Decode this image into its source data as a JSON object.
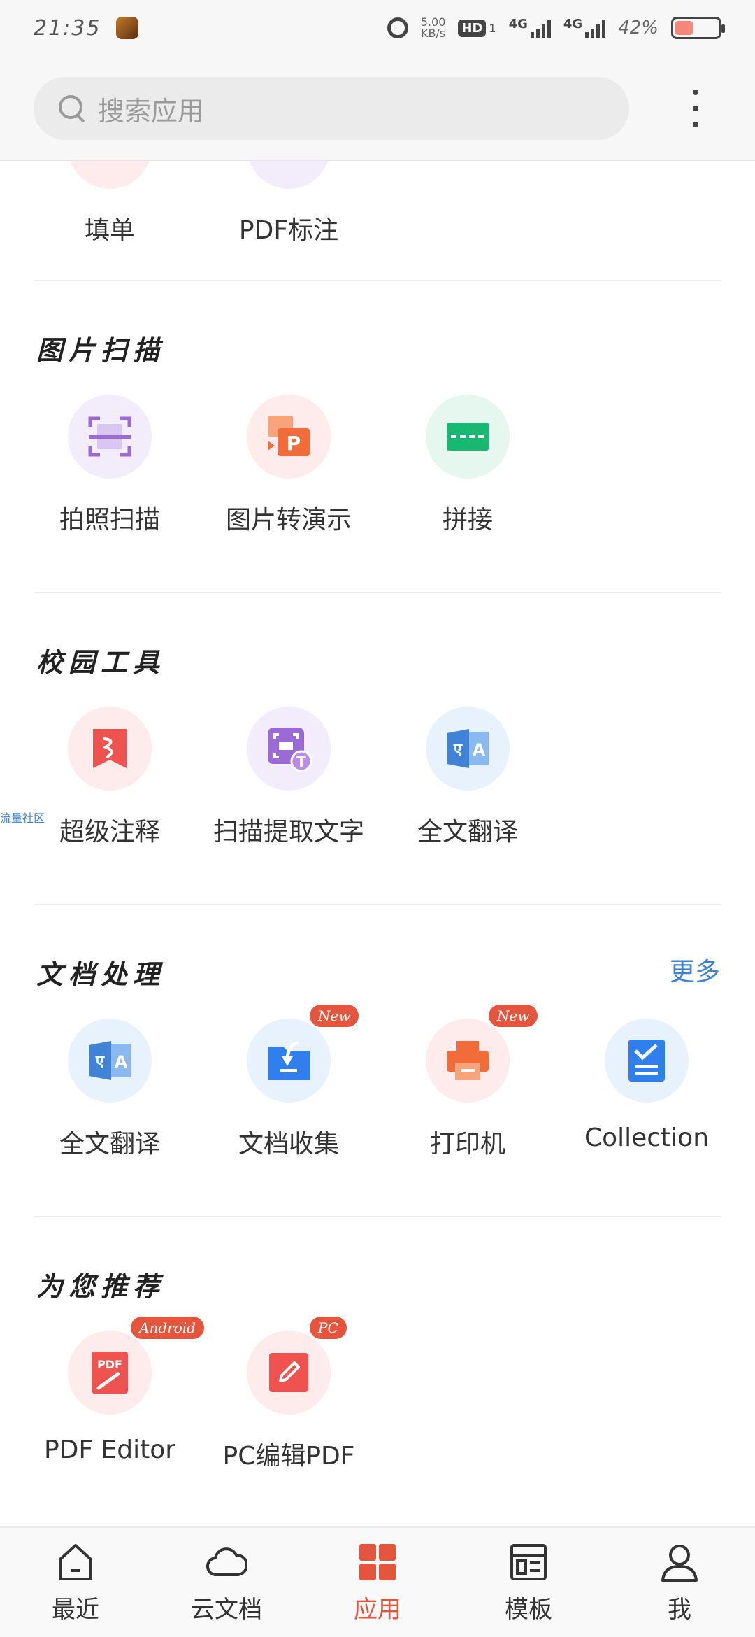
{
  "status": {
    "time": "21:35",
    "net_speed_value": "5.00",
    "net_speed_unit": "KB/s",
    "hd_label": "HD",
    "hd_sub": "1",
    "signal1_label": "4G",
    "signal2_label": "4G",
    "battery_percent": "42%",
    "battery_level": 0.42
  },
  "search": {
    "placeholder": "搜索应用"
  },
  "top_partial": {
    "items": [
      {
        "label": "填单",
        "icon": "form-icon"
      },
      {
        "label": "PDF标注",
        "icon": "pdf-annotate-icon"
      }
    ]
  },
  "sections": {
    "image_scan": {
      "title": "图片扫描",
      "items": [
        {
          "label": "拍照扫描",
          "icon": "camera-scan-icon"
        },
        {
          "label": "图片转演示",
          "icon": "image-to-ppt-icon"
        },
        {
          "label": "拼接",
          "icon": "stitch-icon"
        }
      ]
    },
    "campus_tools": {
      "title": "校园工具",
      "items": [
        {
          "label": "超级注释",
          "icon": "super-annotate-icon"
        },
        {
          "label": "扫描提取文字",
          "icon": "ocr-icon"
        },
        {
          "label": "全文翻译",
          "icon": "translate-icon"
        }
      ]
    },
    "doc_processing": {
      "title": "文档处理",
      "more": "更多",
      "items": [
        {
          "label": "全文翻译",
          "icon": "translate-icon",
          "badge": ""
        },
        {
          "label": "文档收集",
          "icon": "doc-collect-icon",
          "badge": "New"
        },
        {
          "label": "打印机",
          "icon": "printer-icon",
          "badge": "New"
        },
        {
          "label": "Collection",
          "icon": "collection-icon",
          "badge": ""
        }
      ]
    },
    "recommended": {
      "title": "为您推荐",
      "items": [
        {
          "label": "PDF Editor",
          "icon": "pdf-editor-icon",
          "badge": "Android"
        },
        {
          "label": "PC编辑PDF",
          "icon": "pc-edit-pdf-icon",
          "badge": "PC"
        }
      ]
    }
  },
  "side_tag": "流量社区",
  "nav": {
    "items": [
      {
        "label": "最近",
        "icon": "home-icon"
      },
      {
        "label": "云文档",
        "icon": "cloud-icon"
      },
      {
        "label": "应用",
        "icon": "apps-icon"
      },
      {
        "label": "模板",
        "icon": "template-icon"
      },
      {
        "label": "我",
        "icon": "profile-icon"
      }
    ]
  },
  "colors": {
    "accent": "#e5543c",
    "link": "#3f82d6"
  },
  "icon_text": {
    "pdf": "PDF",
    "p_letter": "P",
    "t_letter": "T",
    "translate_a": "A",
    "translate_glyph": "ए"
  }
}
